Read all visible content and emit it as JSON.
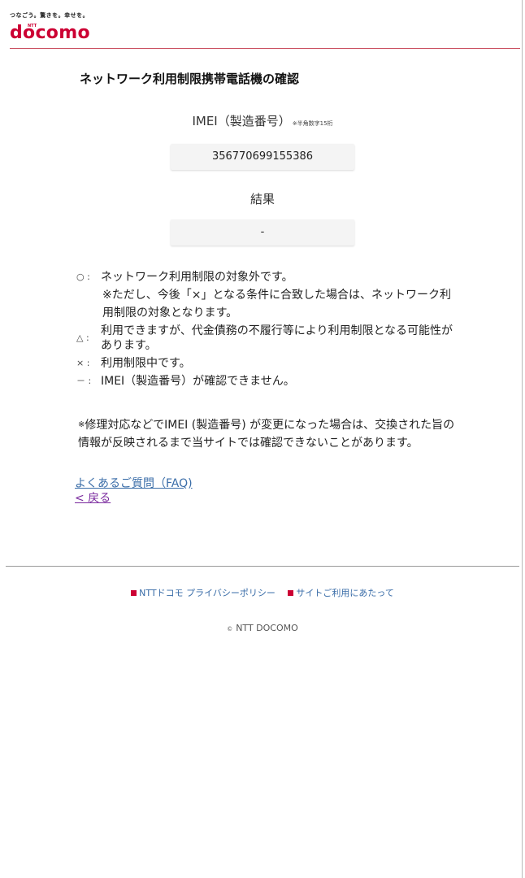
{
  "header": {
    "tagline": "つなごう。驚きを。幸せを。",
    "brand_small": "NTT",
    "brand": "docomo"
  },
  "page": {
    "title": "ネットワーク利用制限携帯電話機の確認"
  },
  "imei": {
    "label": "IMEI（製造番号）",
    "note": "※半角数字15桁",
    "value": "356770699155386"
  },
  "result": {
    "label": "結果",
    "value": "-"
  },
  "legend": [
    {
      "symbol": "○ :",
      "text": "ネットワーク利用制限の対象外です。"
    },
    {
      "symbol": "",
      "text": "※ただし、今後「×」となる条件に合致した場合は、ネットワーク利用制限の対象となります。"
    },
    {
      "symbol": "△ :",
      "text": "利用できますが、代金債務の不履行等により利用制限となる可能性があります。"
    },
    {
      "symbol": "× :",
      "text": "利用制限中です。"
    },
    {
      "symbol": "－ :",
      "text": "IMEI（製造番号）が確認できません。"
    }
  ],
  "notice": {
    "mark": "※",
    "text": "修理対応などでIMEI (製造番号) が変更になった場合は、交換された旨の情報が反映されるまで当サイトでは確認できないことがあります。"
  },
  "links": {
    "faq": "よくあるご質問（FAQ)",
    "back": "< 戻る"
  },
  "footer": {
    "privacy": "NTTドコモ プライバシーポリシー",
    "terms": "サイトご利用にあたって",
    "copyright_symbol": "©",
    "copyright": "NTT DOCOMO"
  },
  "colors": {
    "brand_red": "#cc0033",
    "link_blue": "#3a6da8",
    "visited_purple": "#7a2a9e"
  }
}
